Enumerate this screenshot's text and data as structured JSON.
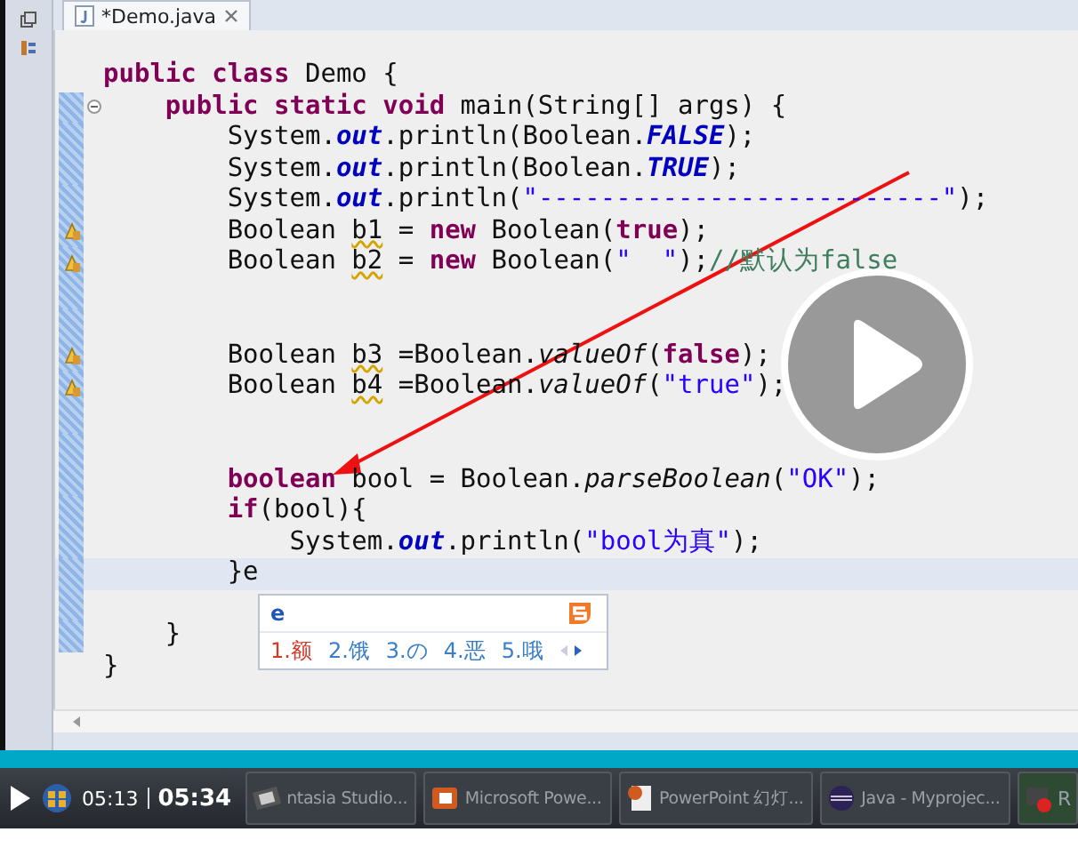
{
  "editor": {
    "tab": {
      "label": "*Demo.java",
      "selected": true
    },
    "lines": [
      {
        "tokens": [
          {
            "kind": "kw",
            "text": "public "
          },
          {
            "kind": "kw",
            "text": "class"
          },
          {
            "kind": "plain",
            "text": " Demo {"
          }
        ],
        "children": [
          {
            "foldable": true,
            "changed": true,
            "tokens": [
              {
                "kind": "kw",
                "text": "public "
              },
              {
                "kind": "kw",
                "text": "static "
              },
              {
                "kind": "kw",
                "text": "void"
              },
              {
                "kind": "plain",
                "text": " main(String[] args) {"
              }
            ],
            "children": [
              {
                "changed": true,
                "tokens": [
                  {
                    "kind": "plain",
                    "text": "System."
                  },
                  {
                    "kind": "field",
                    "text": "out"
                  },
                  {
                    "kind": "plain",
                    "text": ".println(Boolean."
                  },
                  {
                    "kind": "field",
                    "text": "FALSE"
                  },
                  {
                    "kind": "plain",
                    "text": ");"
                  }
                ]
              },
              {
                "changed": true,
                "tokens": [
                  {
                    "kind": "plain",
                    "text": "System."
                  },
                  {
                    "kind": "field",
                    "text": "out"
                  },
                  {
                    "kind": "plain",
                    "text": ".println(Boolean."
                  },
                  {
                    "kind": "field",
                    "text": "TRUE"
                  },
                  {
                    "kind": "plain",
                    "text": ");"
                  }
                ]
              },
              {
                "changed": true,
                "tokens": [
                  {
                    "kind": "plain",
                    "text": "System."
                  },
                  {
                    "kind": "field",
                    "text": "out"
                  },
                  {
                    "kind": "plain",
                    "text": ".println("
                  },
                  {
                    "kind": "str",
                    "text": "\"--------------------------\""
                  },
                  {
                    "kind": "plain",
                    "text": ");"
                  }
                ]
              },
              {
                "warning": true,
                "changed": true,
                "tokens": [
                  {
                    "kind": "plain",
                    "text": "Boolean "
                  },
                  {
                    "kind": "warn",
                    "text": "b1"
                  },
                  {
                    "kind": "plain",
                    "text": " = "
                  },
                  {
                    "kind": "kw",
                    "text": "new"
                  },
                  {
                    "kind": "plain",
                    "text": " Boolean("
                  },
                  {
                    "kind": "kw",
                    "text": "true"
                  },
                  {
                    "kind": "plain",
                    "text": ");"
                  }
                ]
              },
              {
                "warning": true,
                "changed": true,
                "tokens": [
                  {
                    "kind": "plain",
                    "text": "Boolean "
                  },
                  {
                    "kind": "warn",
                    "text": "b2"
                  },
                  {
                    "kind": "plain",
                    "text": " = "
                  },
                  {
                    "kind": "kw",
                    "text": "new"
                  },
                  {
                    "kind": "plain",
                    "text": " Boolean("
                  },
                  {
                    "kind": "str",
                    "text": "\"  \""
                  },
                  {
                    "kind": "plain",
                    "text": ");"
                  },
                  {
                    "kind": "comment",
                    "text": "//默认为false"
                  }
                ]
              },
              {
                "changed": true
              },
              {
                "changed": true
              },
              {
                "warning": true,
                "changed": true,
                "tokens": [
                  {
                    "kind": "plain",
                    "text": "Boolean "
                  },
                  {
                    "kind": "warn",
                    "text": "b3"
                  },
                  {
                    "kind": "plain",
                    "text": " =Boolean."
                  },
                  {
                    "kind": "method",
                    "text": "valueOf"
                  },
                  {
                    "kind": "plain",
                    "text": "("
                  },
                  {
                    "kind": "kw",
                    "text": "false"
                  },
                  {
                    "kind": "plain",
                    "text": ");"
                  }
                ]
              },
              {
                "warning": true,
                "changed": true,
                "tokens": [
                  {
                    "kind": "plain",
                    "text": "Boolean "
                  },
                  {
                    "kind": "warn",
                    "text": "b4"
                  },
                  {
                    "kind": "plain",
                    "text": " =Boolean."
                  },
                  {
                    "kind": "method",
                    "text": "valueOf"
                  },
                  {
                    "kind": "plain",
                    "text": "("
                  },
                  {
                    "kind": "str",
                    "text": "\"true\""
                  },
                  {
                    "kind": "plain",
                    "text": ");"
                  }
                ]
              },
              {
                "changed": true
              },
              {
                "changed": true
              },
              {
                "changed": true,
                "tokens": [
                  {
                    "kind": "kw",
                    "text": "boolean"
                  },
                  {
                    "kind": "plain",
                    "text": " bool = Boolean."
                  },
                  {
                    "kind": "method",
                    "text": "parseBoolean"
                  },
                  {
                    "kind": "plain",
                    "text": "("
                  },
                  {
                    "kind": "str",
                    "text": "\"OK\""
                  },
                  {
                    "kind": "plain",
                    "text": ");"
                  }
                ]
              },
              {
                "changed": true,
                "tokens": [
                  {
                    "kind": "kw",
                    "text": "if"
                  },
                  {
                    "kind": "plain",
                    "text": "(bool){"
                  }
                ],
                "children": [
                  {
                    "changed": true,
                    "tokens": [
                      {
                        "kind": "plain",
                        "text": "System."
                      },
                      {
                        "kind": "field",
                        "text": "out"
                      },
                      {
                        "kind": "plain",
                        "text": ".println("
                      },
                      {
                        "kind": "str",
                        "text": "\"bool为真\""
                      },
                      {
                        "kind": "plain",
                        "text": ");"
                      }
                    ]
                  }
                ]
              },
              {
                "changed": true,
                "current": true,
                "tokens": [
                  {
                    "kind": "plain",
                    "text": "}e"
                  }
                ]
              },
              {
                "changed": true
              }
            ]
          },
          {
            "changed": true,
            "tokens": [
              {
                "kind": "plain",
                "text": "}"
              }
            ]
          }
        ]
      },
      {
        "tokens": [
          {
            "kind": "plain",
            "text": "}"
          }
        ]
      }
    ]
  },
  "ime": {
    "input": "e",
    "candidates": [
      {
        "text": "1.额",
        "selected": true
      },
      {
        "text": "2.饿",
        "selected": false
      },
      {
        "text": "3.の",
        "selected": false
      },
      {
        "text": "4.恶",
        "selected": false
      },
      {
        "text": "5.哦",
        "selected": false
      }
    ]
  },
  "player": {
    "playing": false,
    "progress": {
      "level": 1
    },
    "current_time": "05:13",
    "duration": "05:34"
  },
  "taskbar": [
    {
      "kind": "film",
      "label": "ntasia Studio..."
    },
    {
      "kind": "ppt",
      "label": "Microsoft Powe..."
    },
    {
      "kind": "doc",
      "label": "PowerPoint 幻灯..."
    },
    {
      "kind": "eclipse",
      "label": "Java - Myprojec..."
    },
    {
      "kind": "record",
      "label": "R"
    }
  ]
}
